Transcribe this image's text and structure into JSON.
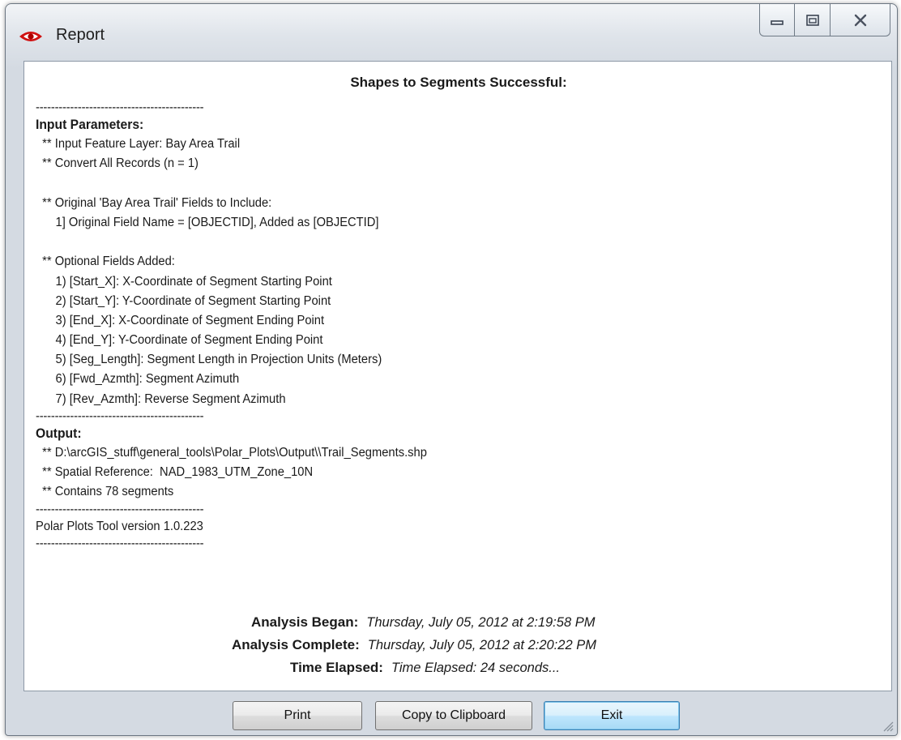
{
  "window": {
    "title": "Report",
    "icon": "red-eye-icon",
    "controls": [
      "minimize-icon",
      "maximize-icon",
      "close-icon"
    ]
  },
  "report": {
    "title": "Shapes to Segments Successful:",
    "lines": [
      {
        "kind": "dash",
        "text": "--------------------------------------------"
      },
      {
        "kind": "head",
        "text": "Input Parameters:"
      },
      {
        "kind": "text",
        "text": "  ** Input Feature Layer: Bay Area Trail"
      },
      {
        "kind": "text",
        "text": "  ** Convert All Records (n = 1)"
      },
      {
        "kind": "blank",
        "text": ""
      },
      {
        "kind": "text",
        "text": "  ** Original 'Bay Area Trail' Fields to Include:"
      },
      {
        "kind": "text",
        "text": "      1] Original Field Name = [OBJECTID], Added as [OBJECTID]"
      },
      {
        "kind": "blank",
        "text": ""
      },
      {
        "kind": "text",
        "text": "  ** Optional Fields Added:"
      },
      {
        "kind": "text",
        "text": "      1) [Start_X]: X-Coordinate of Segment Starting Point"
      },
      {
        "kind": "text",
        "text": "      2) [Start_Y]: Y-Coordinate of Segment Starting Point"
      },
      {
        "kind": "text",
        "text": "      3) [End_X]: X-Coordinate of Segment Ending Point"
      },
      {
        "kind": "text",
        "text": "      4) [End_Y]: Y-Coordinate of Segment Ending Point"
      },
      {
        "kind": "text",
        "text": "      5) [Seg_Length]: Segment Length in Projection Units (Meters)"
      },
      {
        "kind": "text",
        "text": "      6) [Fwd_Azmth]: Segment Azimuth"
      },
      {
        "kind": "text",
        "text": "      7) [Rev_Azmth]: Reverse Segment Azimuth"
      },
      {
        "kind": "dash",
        "text": "--------------------------------------------"
      },
      {
        "kind": "head",
        "text": "Output:"
      },
      {
        "kind": "text",
        "text": "  ** D:\\arcGIS_stuff\\general_tools\\Polar_Plots\\Output\\\\Trail_Segments.shp"
      },
      {
        "kind": "text",
        "text": "  ** Spatial Reference:  NAD_1983_UTM_Zone_10N"
      },
      {
        "kind": "text",
        "text": "  ** Contains 78 segments"
      },
      {
        "kind": "dash",
        "text": "--------------------------------------------"
      },
      {
        "kind": "text",
        "text": "Polar Plots Tool version 1.0.223"
      },
      {
        "kind": "dash",
        "text": "--------------------------------------------"
      }
    ],
    "footer": [
      {
        "label": "Analysis Began:",
        "value": "Thursday, July 05, 2012 at 2:19:58 PM"
      },
      {
        "label": "Analysis Complete:",
        "value": "Thursday, July 05, 2012 at 2:20:22 PM"
      },
      {
        "label": "Time Elapsed:",
        "value": "Time Elapsed: 24 seconds..."
      }
    ]
  },
  "buttons": {
    "print": "Print",
    "copy": "Copy to Clipboard",
    "exit": "Exit"
  }
}
